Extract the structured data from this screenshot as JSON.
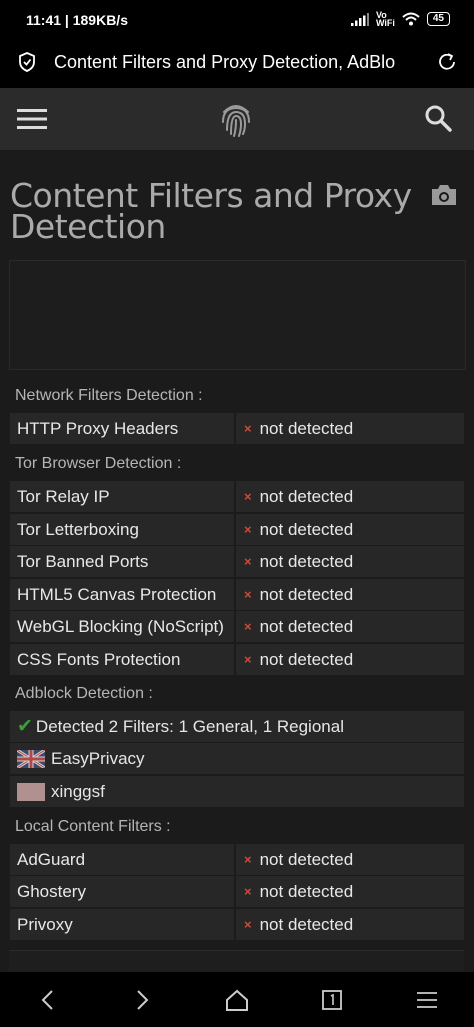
{
  "status": {
    "time": "11:41 | 189KB/s",
    "vo": "Vo",
    "wifi": "WiFi",
    "battery": "45"
  },
  "browser": {
    "title": "Content Filters and Proxy Detection, AdBlo"
  },
  "page": {
    "title": "Content Filters and Proxy Detection"
  },
  "network": {
    "label": "Network Filters Detection :",
    "rows": [
      {
        "name": "HTTP Proxy Headers",
        "value": "not detected"
      }
    ]
  },
  "tor": {
    "label": "Tor Browser Detection :",
    "rows": [
      {
        "name": "Tor Relay IP",
        "value": "not detected"
      },
      {
        "name": "Tor Letterboxing",
        "value": "not detected"
      },
      {
        "name": "Tor Banned Ports",
        "value": "not detected"
      },
      {
        "name": "HTML5 Canvas Protection",
        "value": "not detected"
      },
      {
        "name": "WebGL Blocking (NoScript)",
        "value": "not detected"
      },
      {
        "name": "CSS Fonts Protection",
        "value": "not detected"
      }
    ]
  },
  "adblock": {
    "label": "Adblock Detection :",
    "summary": "Detected 2 Filters: 1 General, 1 Regional",
    "filters": [
      {
        "name": "EasyPrivacy",
        "flag": "uk-flag"
      },
      {
        "name": "xinggsf",
        "flag": "cn-flag"
      }
    ]
  },
  "local": {
    "label": "Local Content Filters :",
    "rows": [
      {
        "name": "AdGuard",
        "value": "not detected"
      },
      {
        "name": "Ghostery",
        "value": "not detected"
      },
      {
        "name": "Privoxy",
        "value": "not detected"
      }
    ]
  },
  "icons": {
    "x": "×",
    "check": "✔"
  }
}
